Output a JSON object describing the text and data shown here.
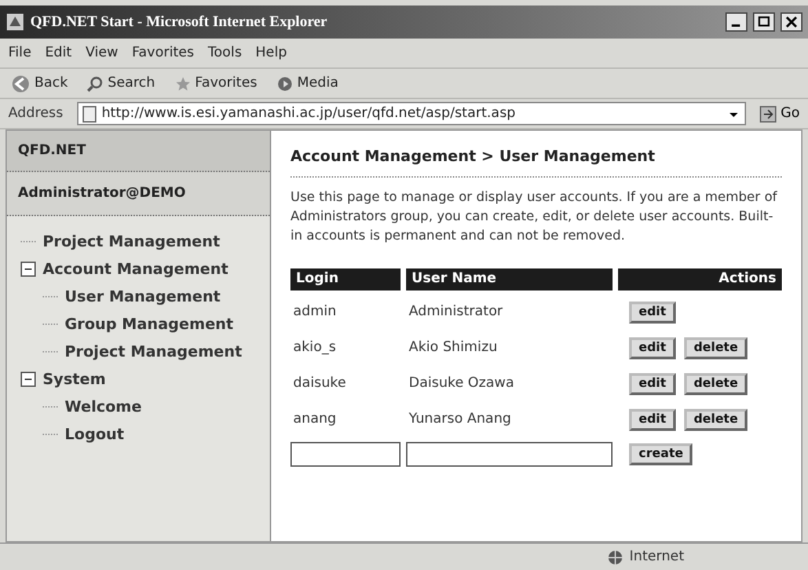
{
  "window": {
    "title": "QFD.NET Start - Microsoft Internet Explorer"
  },
  "menu": [
    "File",
    "Edit",
    "View",
    "Favorites",
    "Tools",
    "Help"
  ],
  "toolbar": [
    {
      "kind": "back",
      "label": "Back"
    },
    {
      "kind": "search",
      "label": "Search"
    },
    {
      "kind": "favorites",
      "label": "Favorites"
    },
    {
      "kind": "media",
      "label": "Media"
    }
  ],
  "address": {
    "label": "Address",
    "url": "http://www.is.esi.yamanashi.ac.jp/user/qfd.net/asp/start.asp",
    "go": "Go"
  },
  "sidebar": {
    "header": "QFD.NET",
    "user": "Administrator@DEMO",
    "items": [
      {
        "label": "Project Management"
      },
      {
        "label": "Account Management",
        "expanded": true,
        "children": [
          {
            "label": "User Management"
          },
          {
            "label": "Group Management"
          },
          {
            "label": "Project Management"
          }
        ]
      },
      {
        "label": "System",
        "expanded": true,
        "children": [
          {
            "label": "Welcome"
          },
          {
            "label": "Logout"
          }
        ]
      }
    ]
  },
  "main": {
    "breadcrumb": "Account Management > User Management",
    "description": "Use this page to manage or display user accounts. If you are a member of Administrators group, you can create, edit, or delete user accounts. Built-in accounts is permanent and can not be removed.",
    "table": {
      "columns": [
        "Login",
        "User Name",
        "Actions"
      ],
      "rows": [
        {
          "login": "admin",
          "user_name": "Administrator",
          "actions": [
            "edit"
          ]
        },
        {
          "login": "akio_s",
          "user_name": "Akio Shimizu",
          "actions": [
            "edit",
            "delete"
          ]
        },
        {
          "login": "daisuke",
          "user_name": "Daisuke Ozawa",
          "actions": [
            "edit",
            "delete"
          ]
        },
        {
          "login": "anang",
          "user_name": "Yunarso Anang",
          "actions": [
            "edit",
            "delete"
          ]
        }
      ],
      "create_button": "create"
    }
  },
  "status_bar": {
    "zone": "Internet"
  }
}
